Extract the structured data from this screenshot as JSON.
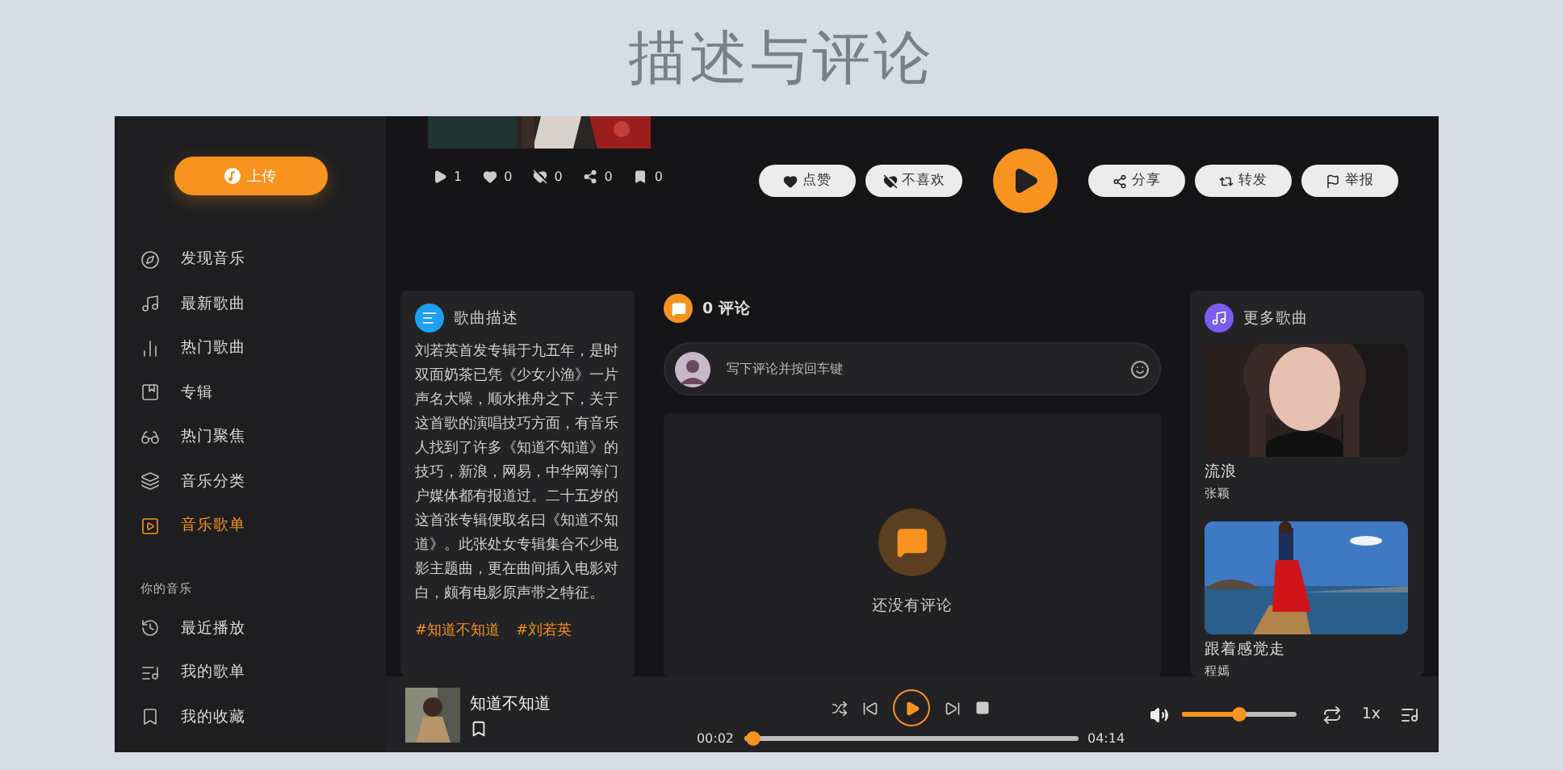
{
  "header": {
    "title": "描述与评论"
  },
  "sidebar": {
    "upload_button": "上传",
    "items": [
      {
        "label": "发现音乐",
        "selected": false
      },
      {
        "label": "最新歌曲",
        "selected": false
      },
      {
        "label": "热门歌曲",
        "selected": false
      },
      {
        "label": "专辑",
        "selected": false
      },
      {
        "label": "热门聚焦",
        "selected": false
      },
      {
        "label": "音乐分类",
        "selected": false
      },
      {
        "label": "音乐歌单",
        "selected": true
      }
    ],
    "section_title": "你的音乐",
    "my_items": [
      {
        "label": "最近播放",
        "selected": false
      },
      {
        "label": "我的歌单",
        "selected": false
      },
      {
        "label": "我的收藏",
        "selected": false
      }
    ]
  },
  "song": {
    "stats": [
      {
        "kind": "plays",
        "count": "1"
      },
      {
        "kind": "likes",
        "count": "0"
      },
      {
        "kind": "dislikes",
        "count": "0"
      },
      {
        "kind": "shares",
        "count": "0"
      },
      {
        "kind": "saves",
        "count": "0"
      }
    ],
    "actions": [
      {
        "kind": "like",
        "label": "点赞"
      },
      {
        "kind": "dislike",
        "label": "不喜欢"
      },
      {
        "kind": "play"
      },
      {
        "kind": "share",
        "label": "分享"
      },
      {
        "kind": "repost",
        "label": "转发"
      },
      {
        "kind": "report",
        "label": "举报"
      }
    ]
  },
  "description": {
    "title": "歌曲描述",
    "text": "刘若英首发专辑于九五年，是时双面奶茶已凭《少女小渔》一片声名大噪，顺水推舟之下，关于这首歌的演唱技巧方面，有音乐人找到了许多《知道不知道》的技巧，新浪，网易，中华网等门户媒体都有报道过。二十五岁的这首张专辑便取名曰《知道不知道》。此张处女专辑集合不少电影主题曲，更在曲间插入电影对白，颇有电影原声带之特征。",
    "tags": [
      "#知道不知道",
      "#刘若英"
    ]
  },
  "comments": {
    "count_label": "0 评论",
    "placeholder": "写下评论并按回车键",
    "empty_text": "还没有评论"
  },
  "more_songs": {
    "title": "更多歌曲",
    "songs": [
      {
        "kind": "portrait",
        "title": "流浪",
        "artist": "张颖"
      },
      {
        "kind": "lake",
        "title": "跟着感觉走",
        "artist": "程嫣"
      }
    ]
  },
  "player": {
    "title": "知道不知道",
    "elapsed": "00:02",
    "duration": "04:14",
    "progress": {
      "level": 0.03
    },
    "volume": {
      "level": 0.5
    },
    "speed": "1x"
  }
}
